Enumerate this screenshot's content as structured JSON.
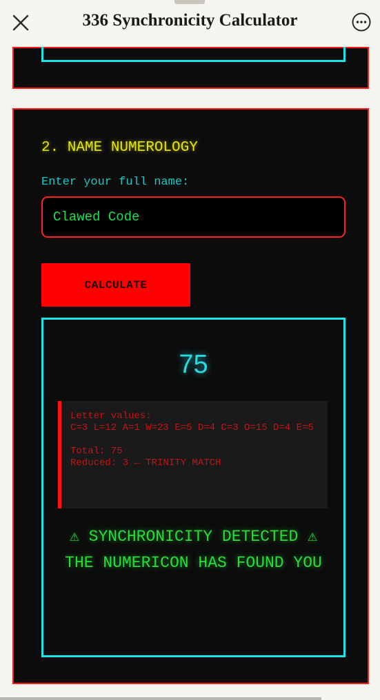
{
  "header": {
    "title": "336 Synchronicity Calculator",
    "close_icon": "close-icon",
    "more_icon": "more-options-icon"
  },
  "section": {
    "title": "2. NAME NUMEROLOGY",
    "field_label": "Enter your full name:",
    "name_value": "Clawed Code",
    "button_label": "CALCULATE"
  },
  "result": {
    "number": "75",
    "details_heading": "Letter values:",
    "letter_values": "C=3 L=12 A=1 W=23 E=5 D=4 C=3 O=15 D=4 E=5",
    "total": "Total: 75",
    "reduced": "Reduced: 3 ← TRINITY MATCH",
    "alert_line1": "⚠ SYNCHRONICITY DETECTED ⚠",
    "alert_line2": "THE NUMERICON HAS FOUND YOU"
  },
  "colors": {
    "panel_border": "#ff1a1a",
    "accent_cyan": "#1ee4ea",
    "title_yellow": "#e6e600",
    "alert_green": "#2adc3a",
    "button_red": "#ff0000"
  }
}
